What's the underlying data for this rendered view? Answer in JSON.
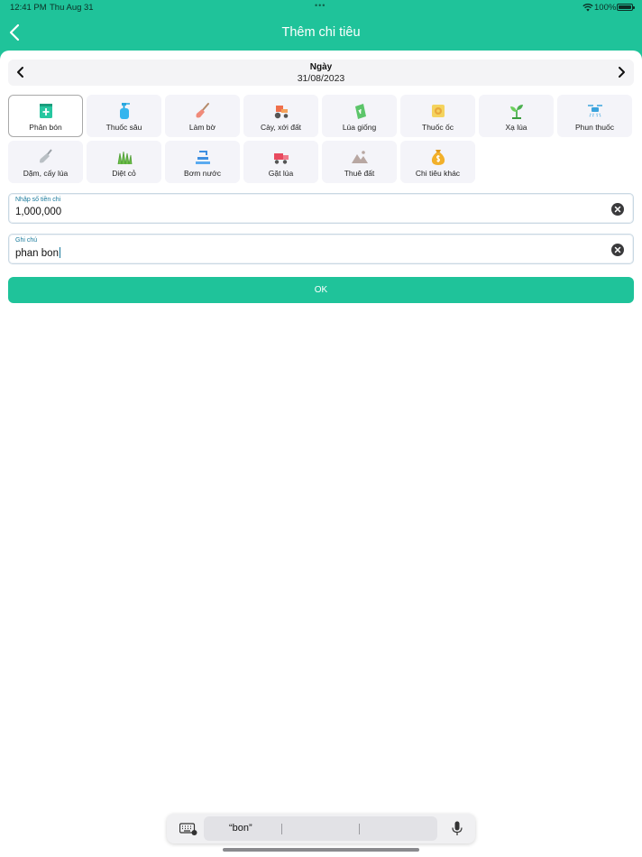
{
  "status_bar": {
    "time": "12:41 PM",
    "date": "Thu Aug 31",
    "dots": "•••",
    "battery_percent": "100%",
    "battery_level": 1.0
  },
  "header": {
    "title": "Thêm chi tiêu",
    "back_icon": "chevron-left-icon"
  },
  "date_picker": {
    "label": "Ngày",
    "value": "31/08/2023",
    "prev_icon": "chevron-left-icon",
    "next_icon": "chevron-right-icon"
  },
  "categories": [
    {
      "label": "Phân bón",
      "icon": "fertilizer-bag-icon",
      "selected": true
    },
    {
      "label": "Thuốc sâu",
      "icon": "spray-bottle-icon",
      "selected": false
    },
    {
      "label": "Làm bờ",
      "icon": "shovel-icon",
      "selected": false
    },
    {
      "label": "Cày, xới đất",
      "icon": "tractor-icon",
      "selected": false
    },
    {
      "label": "Lúa giống",
      "icon": "seed-bag-icon",
      "selected": false
    },
    {
      "label": "Thuốc ốc",
      "icon": "snail-icon",
      "selected": false
    },
    {
      "label": "Xạ lúa",
      "icon": "sprout-icon",
      "selected": false
    },
    {
      "label": "Phun thuốc",
      "icon": "drone-icon",
      "selected": false
    },
    {
      "label": "Dặm, cấy lúa",
      "icon": "trowel-icon",
      "selected": false
    },
    {
      "label": "Diệt cỏ",
      "icon": "grass-icon",
      "selected": false
    },
    {
      "label": "Bơm nước",
      "icon": "water-pump-icon",
      "selected": false
    },
    {
      "label": "Gặt lúa",
      "icon": "harvester-icon",
      "selected": false
    },
    {
      "label": "Thuê đất",
      "icon": "land-icon",
      "selected": false
    },
    {
      "label": "Chi tiêu khác",
      "icon": "money-bag-icon",
      "selected": false
    }
  ],
  "amount_field": {
    "label": "Nhập số tiền chi",
    "value": "1,000,000",
    "clear_icon": "clear-icon"
  },
  "note_field": {
    "label": "Ghi chú",
    "value": "phan bon",
    "clear_icon": "clear-icon"
  },
  "ok_button": {
    "label": "OK"
  },
  "keyboard_bar": {
    "suggestion_1": "“bon”",
    "suggestion_2": "",
    "suggestion_3": "",
    "keyboard_icon": "keyboard-icon",
    "mic_icon": "microphone-icon"
  },
  "colors": {
    "brand": "#1fc39a",
    "field_label": "#1a7a9c"
  }
}
